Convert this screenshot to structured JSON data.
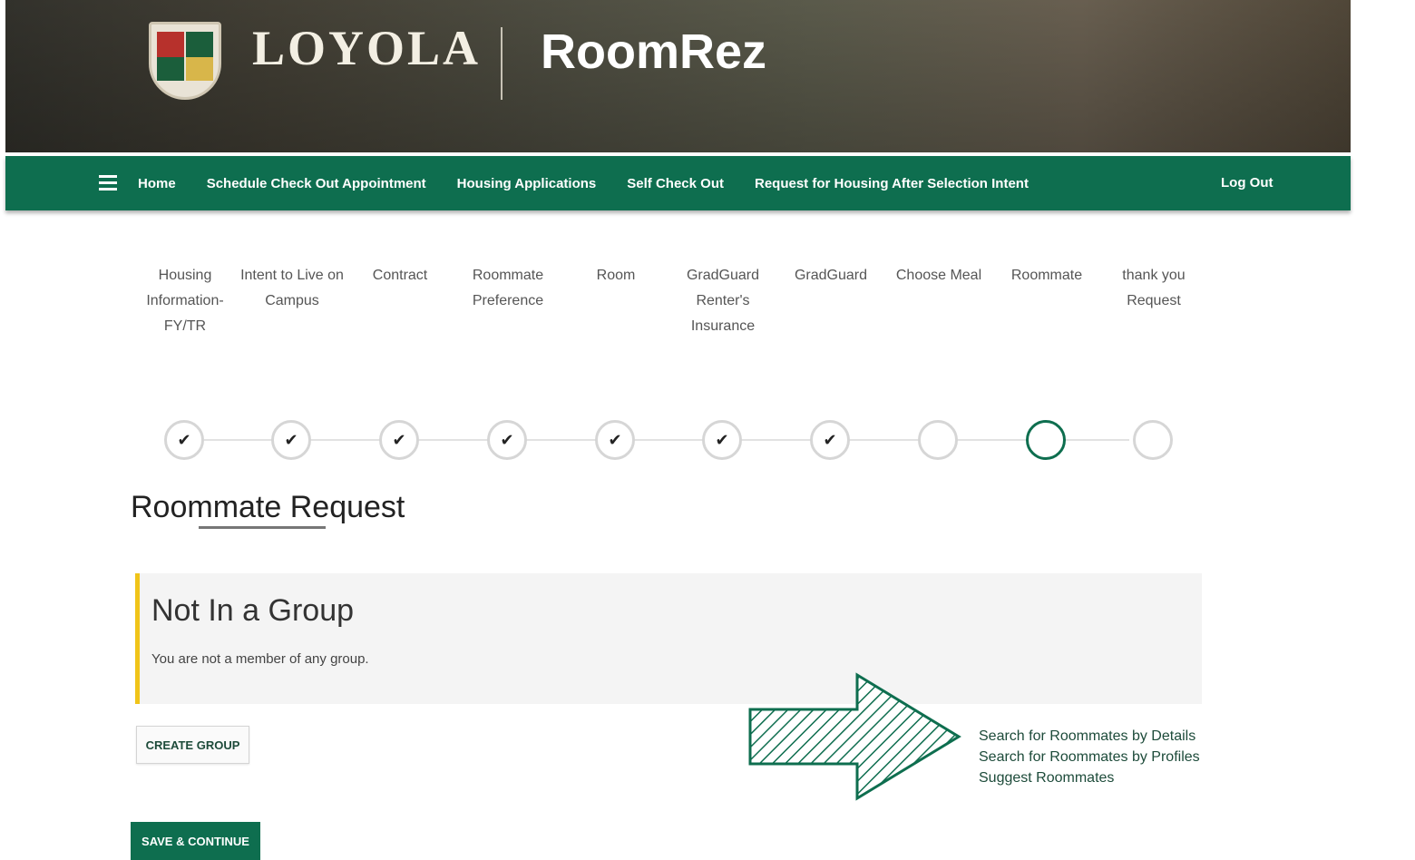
{
  "header": {
    "brand": "LOYOLA",
    "app_title": "RoomRez"
  },
  "nav": {
    "items": [
      "Home",
      "Schedule Check Out Appointment",
      "Housing Applications",
      "Self Check Out",
      "Request for Housing After Selection Intent"
    ],
    "logout": "Log Out"
  },
  "steps": [
    {
      "label": "Housing Information- FY/TR",
      "status": "complete"
    },
    {
      "label": "Intent to Live on Campus",
      "status": "complete"
    },
    {
      "label": "Contract",
      "status": "complete"
    },
    {
      "label": "Roommate Preference",
      "status": "complete"
    },
    {
      "label": "Room",
      "status": "complete"
    },
    {
      "label": "GradGuard Renter's Insurance",
      "status": "complete"
    },
    {
      "label": "GradGuard",
      "status": "complete"
    },
    {
      "label": "Choose Meal",
      "status": "pending"
    },
    {
      "label": "Roommate",
      "status": "current"
    },
    {
      "label": "thank you Request",
      "status": "pending"
    }
  ],
  "page": {
    "title": "Roommate Request"
  },
  "group": {
    "title": "Not In a Group",
    "message": "You are not a member of any group."
  },
  "buttons": {
    "create_group": "CREATE GROUP",
    "save_continue": "SAVE & CONTINUE"
  },
  "search_options": [
    "Search for Roommates by Details",
    "Search for Roommates by Profiles",
    "Suggest Roommates"
  ],
  "colors": {
    "primary": "#0e6e4f",
    "accent": "#f0c419"
  },
  "icons": {
    "check": "✔",
    "menu": "menu-icon"
  }
}
